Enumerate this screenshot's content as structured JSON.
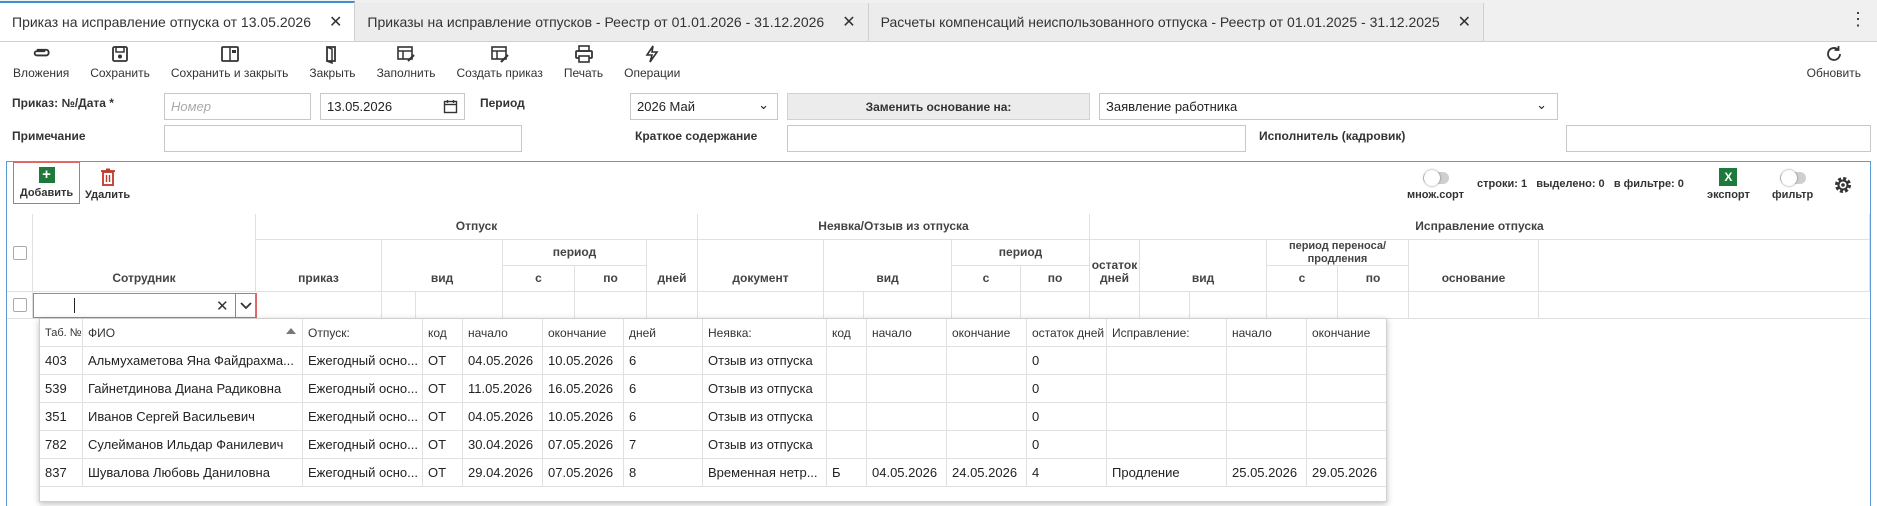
{
  "tabs": [
    {
      "label": "Приказ на исправление отпуска от 13.05.2026",
      "active": true
    },
    {
      "label": "Приказы на исправление отпусков - Реестр от 01.01.2026 - 31.12.2026",
      "active": false
    },
    {
      "label": "Расчеты компенсаций неиспользованного отпуска - Реестр от 01.01.2025 - 31.12.2025",
      "active": false
    }
  ],
  "toolbar": {
    "attachments": "Вложения",
    "save": "Сохранить",
    "save_close": "Сохранить и закрыть",
    "close": "Закрыть",
    "fill": "Заполнить",
    "create_order": "Создать приказ",
    "print": "Печать",
    "operations": "Операции",
    "refresh": "Обновить"
  },
  "form": {
    "order_label": "Приказ: №/Дата *",
    "number_placeholder": "Номер",
    "date_value": "13.05.2026",
    "period_label": "Период",
    "period_value": "2026 Май",
    "replace_basis_button": "Заменить основание на:",
    "basis_value": "Заявление работника",
    "note_label": "Примечание",
    "note_value": "",
    "summary_label": "Краткое содержание",
    "summary_value": "",
    "executor_label": "Исполнитель (кадровик)",
    "executor_value": ""
  },
  "grid_toolbar": {
    "add": "Добавить",
    "delete": "Удалить",
    "multisort": "множ.сорт",
    "rows_label": "строки:",
    "rows_count": "1",
    "selected_label": "выделено:",
    "selected_count": "0",
    "in_filter_label": "в фильтре:",
    "in_filter_count": "0",
    "export": "экспорт",
    "filter": "фильтр"
  },
  "grid_header": {
    "employee": "Сотрудник",
    "vacation_group": "Отпуск",
    "order": "приказ",
    "kind": "вид",
    "period": "период",
    "from": "с",
    "to": "по",
    "days": "дней",
    "absence_group": "Неявка/Отзыв из отпуска",
    "document": "документ",
    "absence_kind": "вид",
    "absence_period": "период",
    "absence_from": "с",
    "absence_to": "по",
    "correction_group": "Исправление отпуска",
    "remaining_days": "остаток дней",
    "correction_kind": "вид",
    "transfer_period": "период переноса/продления",
    "transfer_from": "с",
    "transfer_to": "по",
    "basis": "основание"
  },
  "dropdown": {
    "headers": [
      "Таб. №",
      "ФИО",
      "Отпуск:",
      "код",
      "начало",
      "окончание",
      "дней",
      "Неявка:",
      "код",
      "начало",
      "окончание",
      "остаток дней",
      "Исправление:",
      "начало",
      "окончание"
    ],
    "rows": [
      [
        "403",
        "Альмухаметова Яна Файдрахма...",
        "Ежегодный осно...",
        "ОТ",
        "04.05.2026",
        "10.05.2026",
        "6",
        "Отзыв из отпуска",
        "",
        "",
        "",
        "0",
        "",
        "",
        ""
      ],
      [
        "539",
        "Гайнетдинова Диана Радиковна",
        "Ежегодный осно...",
        "ОТ",
        "11.05.2026",
        "16.05.2026",
        "6",
        "Отзыв из отпуска",
        "",
        "",
        "",
        "0",
        "",
        "",
        ""
      ],
      [
        "351",
        "Иванов Сергей Васильевич",
        "Ежегодный осно...",
        "ОТ",
        "04.05.2026",
        "10.05.2026",
        "6",
        "Отзыв из отпуска",
        "",
        "",
        "",
        "0",
        "",
        "",
        ""
      ],
      [
        "782",
        "Сулейманов Ильдар Фанилевич",
        "Ежегодный осно...",
        "ОТ",
        "30.04.2026",
        "07.05.2026",
        "7",
        "Отзыв из отпуска",
        "",
        "",
        "",
        "0",
        "",
        "",
        ""
      ],
      [
        "837",
        "Шувалова Любовь Даниловна",
        "Ежегодный осно...",
        "ОТ",
        "29.04.2026",
        "07.05.2026",
        "8",
        "Временная нетр...",
        "Б",
        "04.05.2026",
        "24.05.2026",
        "4",
        "Продление",
        "25.05.2026",
        "29.05.2026"
      ]
    ]
  },
  "colors": {
    "accent": "#3d8fd8",
    "add_green": "#1d7a3a",
    "delete_red": "#c0392b",
    "highlight_red": "#e06666"
  }
}
